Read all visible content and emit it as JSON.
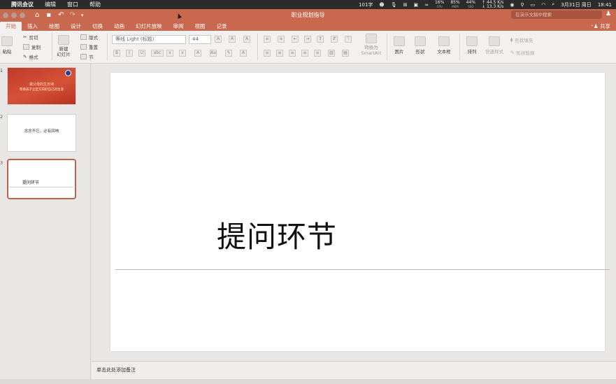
{
  "menubar": {
    "app_name": "腾讯会议",
    "items": [
      "编辑",
      "窗口",
      "帮助"
    ],
    "word_count": "101字",
    "cpu": {
      "value": "16%",
      "label": "CPU"
    },
    "mem": {
      "value": "85%",
      "label": "MEM"
    },
    "ssd": {
      "value": "44%",
      "label": "SSD"
    },
    "net_up": "↑ 44.5 K/s",
    "net_down": "↓ 13.3 K/s",
    "date": "3月31日 周日",
    "time": "18:41"
  },
  "window": {
    "title": "职业规划指导",
    "search_placeholder": "在演示文稿中搜索",
    "share_label": "共享"
  },
  "tabs": [
    "开始",
    "插入",
    "绘图",
    "设计",
    "切换",
    "动画",
    "幻灯片放映",
    "审阅",
    "视图",
    "记录"
  ],
  "ribbon": {
    "paste": "粘贴",
    "cut": "剪切",
    "copy": "复制",
    "format": "格式",
    "new_slide": "新建\n幻灯片",
    "layout": "版式",
    "reset": "重置",
    "section": "节",
    "font_name": "等线 Light (标题)",
    "font_size": "44",
    "convert_smartart": "转换为\nSmartArt",
    "picture": "图片",
    "shape": "形状",
    "textbox": "文本框",
    "arrange": "排列",
    "quick_styles": "快速样式",
    "shape_fill": "形状填充",
    "shape_outline": "形状轮廓"
  },
  "slides": [
    {
      "number": "1",
      "line1": "做父母的生日诗",
      "line2": "帮助孩子立定方向好自己的生涯"
    },
    {
      "number": "2",
      "text": "念念不忘，必有回响"
    },
    {
      "number": "3",
      "text": "提问环节"
    }
  ],
  "current_slide": {
    "title": "提问环节"
  },
  "notes_placeholder": "单击此处添加备注"
}
